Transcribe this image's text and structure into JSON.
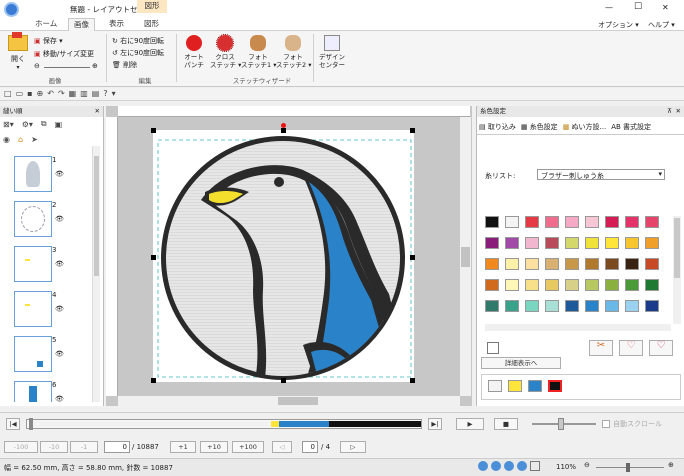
{
  "window": {
    "title": "無題 - レイアウトセンター",
    "context_tab": "図形",
    "minimize": "—",
    "maximize": "☐",
    "close": "✕"
  },
  "tabs": [
    {
      "label": "ホーム"
    },
    {
      "label": "画像"
    },
    {
      "label": "表示"
    },
    {
      "label": "図形"
    }
  ],
  "right_menu": {
    "options": "オプション ▾",
    "help": "ヘルプ ▾"
  },
  "ribbon": {
    "image_group": {
      "open": "開く",
      "save": "保存 ▾",
      "move_resize": "移動/サイズ変更",
      "label": "画像"
    },
    "edit_group": {
      "rotate_right": "右に90度回転",
      "rotate_left": "左に90度回転",
      "delete": "削除",
      "label": "編集"
    },
    "wizard_group": {
      "auto_punch": "オート\nパンチ",
      "cross_stitch": "クロス\nステッチ ▾",
      "photo1": "フォト\nステッチ1 ▾",
      "photo2": "フォト\nステッチ2 ▾",
      "label": "ステッチウィザード"
    },
    "design_center": "デザイン\nセンター"
  },
  "left_panel": {
    "title": "縫い順",
    "thumb_numbers": [
      "1",
      "2",
      "3",
      "4",
      "5",
      "6"
    ]
  },
  "right_panel": {
    "title": "糸色設定",
    "tabs": [
      "取り込み",
      "糸色設定",
      "ぬい方設...",
      "AB 書式設定"
    ],
    "thread_list_label": "糸リスト:",
    "thread_list_value": "ブラザー刺しゅう糸",
    "detail_button": "詳細表示へ",
    "palette": [
      [
        "#111111",
        "#f4f4f4",
        "#e53945",
        "#f06c8c",
        "#f5a9c5",
        "#f7c7d6",
        "#d51d55",
        "#e5326a",
        "#e5456a"
      ],
      [
        "#8a1c7a",
        "#a24aa8",
        "#f2b6cf",
        "#b84a5a",
        "#d4d86a",
        "#f1e23a",
        "#ffe43a",
        "#f7c52e",
        "#f0a02a"
      ],
      [
        "#f0881e",
        "#fff0a8",
        "#fde0a0",
        "#d9b070",
        "#c89848",
        "#b07a2c",
        "#7a4a1e",
        "#3a2210",
        "#c84a24"
      ],
      [
        "#d26a1e",
        "#fff6b8",
        "#f8e08a",
        "#e8c860",
        "#d6d088",
        "#b8c860",
        "#8ab040",
        "#4a9a38",
        "#1e7a30"
      ],
      [
        "#2f7a6a",
        "#3aa28a",
        "#7ad6c0",
        "#a8e0d8",
        "#1e5a9a",
        "#2a82c8",
        "#6ab8e8",
        "#9ad0f0",
        "#1a3a8a"
      ]
    ],
    "used_colors": [
      "#f4f4f4",
      "#ffe43a",
      "#2a82c8",
      "#111111"
    ]
  },
  "playback": {
    "total": "/ 10887"
  },
  "stepbar": {
    "m100": "-100",
    "m10": "-10",
    "m1": "-1",
    "stitch": "0",
    "total": "/ 10887",
    "p1": "+1",
    "p10": "+10",
    "p100": "+100",
    "page": "0",
    "pages": "/ 4",
    "checkbox_label": "自動スクロール"
  },
  "statusbar": {
    "text": "幅 = 62.50 mm, 高さ = 58.80 mm, 針数 = 10887",
    "zoom": "110%"
  }
}
